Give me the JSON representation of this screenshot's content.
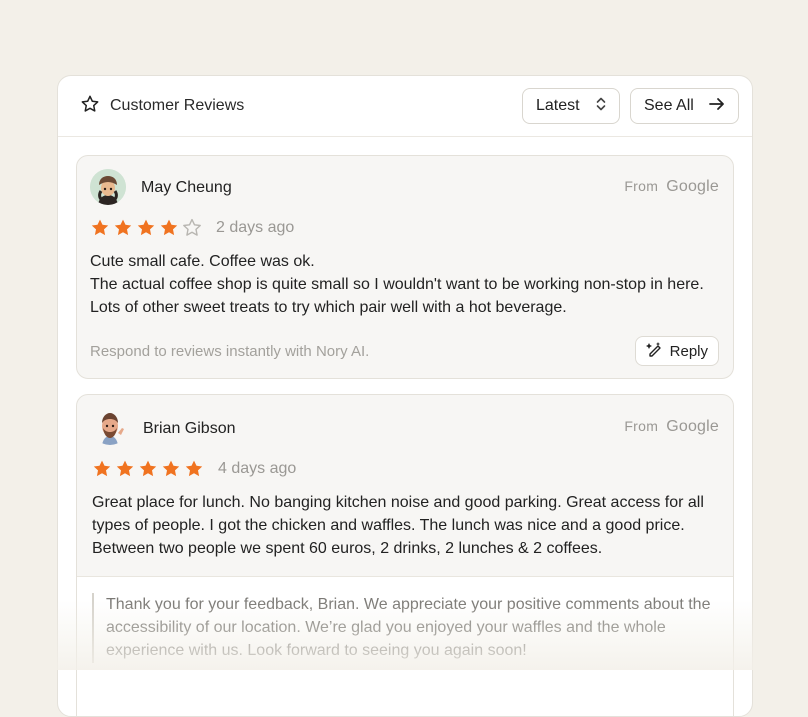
{
  "header": {
    "title": "Customer Reviews",
    "icon": "star-outline-icon",
    "sort_label": "Latest",
    "see_all_label": "See All"
  },
  "colors": {
    "star": "#f07320",
    "star_empty": "#b8b6b1",
    "background": "#f3f0e9"
  },
  "reviews": [
    {
      "name": "May Cheung",
      "source_from": "From",
      "source_name": "Google",
      "rating": 4,
      "max_rating": 5,
      "time": "2 days ago",
      "text_lines": [
        "Cute small cafe. Coffee was ok.",
        "The actual coffee shop is quite small so I wouldn't want to be working non-stop in here. Lots of other sweet treats to try which pair well with a hot beverage."
      ],
      "hint": "Respond to reviews instantly with Nory AI.",
      "reply_label": "Reply"
    },
    {
      "name": "Brian Gibson",
      "source_from": "From",
      "source_name": "Google",
      "rating": 5,
      "max_rating": 5,
      "time": "4 days ago",
      "text": "Great place for lunch. No banging kitchen noise and good parking. Great access for all types of people. I got the chicken and waffles. The lunch was nice and a good price. Between two people we spent 60 euros, 2 drinks, 2 lunches & 2 coffees.",
      "response": "Thank you for your feedback, Brian. We appreciate your positive comments about the accessibility of our location. We’re glad you enjoyed your waffles and the whole experience with us. Look forward to seeing you again soon!"
    }
  ]
}
